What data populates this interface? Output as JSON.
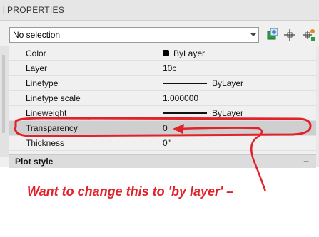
{
  "panel": {
    "title": "PROPERTIES",
    "selection": "No selection",
    "toolbar_icons": [
      "quick-select-icon",
      "select-objects-icon",
      "toggle-pickadd-icon"
    ]
  },
  "properties": [
    {
      "name": "Color",
      "value": "ByLayer",
      "swatch_color": "#000000"
    },
    {
      "name": "Layer",
      "value": "10c"
    },
    {
      "name": "Linetype",
      "value": "ByLayer"
    },
    {
      "name": "Linetype scale",
      "value": "1.000000"
    },
    {
      "name": "Lineweight",
      "value": "ByLayer"
    },
    {
      "name": "Transparency",
      "value": "0"
    },
    {
      "name": "Thickness",
      "value": "0\""
    }
  ],
  "section": {
    "label": "Plot style",
    "toggle": "–"
  },
  "annotation": {
    "text": "Want to change this to 'by layer' –",
    "color": "#e2222b"
  }
}
